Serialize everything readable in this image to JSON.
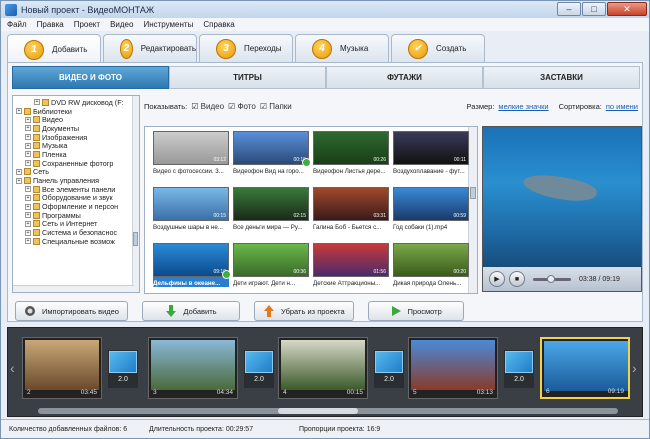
{
  "window": {
    "title": "Новый проект - ВидеоМОНТАЖ",
    "minimize": "–",
    "maximize": "□",
    "close": "✕"
  },
  "menu": [
    "Файл",
    "Правка",
    "Проект",
    "Видео",
    "Инструменты",
    "Справка"
  ],
  "steps": [
    {
      "num": "1",
      "label": "Добавить"
    },
    {
      "num": "2",
      "label": "Редактировать"
    },
    {
      "num": "3",
      "label": "Переходы"
    },
    {
      "num": "4",
      "label": "Музыка"
    },
    {
      "num": "✓",
      "label": "Создать"
    }
  ],
  "subtabs": [
    "ВИДЕО И ФОТО",
    "ТИТРЫ",
    "ФУТАЖИ",
    "ЗАСТАВКИ"
  ],
  "tree": [
    "DVD RW дисковод (F:",
    "Библиотеки",
    "Видео",
    "Документы",
    "Изображения",
    "Музыка",
    "Пленка",
    "Сохраненные фотогр",
    "Сеть",
    "Панель управления",
    "Все элементы панели",
    "Оборудование и звук",
    "Оформление и персон",
    "Программы",
    "Сеть и Интернет",
    "Система и безопаснос",
    "Специальные возмож"
  ],
  "filter": {
    "show_label": "Показывать:",
    "video": "Видео",
    "photo": "Фото",
    "folders": "Папки",
    "size_label": "Размер:",
    "size_value": "мелкие значки",
    "sort_label": "Сортировка:",
    "sort_value": "по имени"
  },
  "files": [
    {
      "name": "Видео с фотосессии. 3...",
      "dur": "03:12"
    },
    {
      "name": "Видеофон Вид на горо...",
      "dur": "00:15"
    },
    {
      "name": "Видеофон Листья дере...",
      "dur": "00:26"
    },
    {
      "name": "Воздухоплавание - фут...",
      "dur": "00:11"
    },
    {
      "name": "Воздушные шары в не...",
      "dur": "00:15"
    },
    {
      "name": "Все деньги мира — Ру...",
      "dur": "02:15"
    },
    {
      "name": "Галина Боб - Бьется с...",
      "dur": "03:31"
    },
    {
      "name": "Год собаки (1).mp4",
      "dur": "00:59"
    },
    {
      "name": "Дельфины в океане...",
      "dur": "09:19"
    },
    {
      "name": "Дети играют. Дети н...",
      "dur": "00:36"
    },
    {
      "name": "Детские Аттракционы...",
      "dur": "01:56"
    },
    {
      "name": "Дикая природа Олень...",
      "dur": "00:20"
    }
  ],
  "player": {
    "time": "03:38 / 09:19",
    "play": "▶",
    "stop": "■"
  },
  "actions": [
    "Импортировать видео",
    "Добавить",
    "Убрать из проекта",
    "Просмотр"
  ],
  "clips": [
    {
      "num": "2",
      "dur": "03:45"
    },
    {
      "num": "3",
      "dur": "04:34"
    },
    {
      "num": "4",
      "dur": "00:15"
    },
    {
      "num": "5",
      "dur": "03:13"
    },
    {
      "num": "6",
      "dur": "09:19"
    }
  ],
  "transitions": [
    "2.0",
    "2.0",
    "2.0",
    "2.0",
    "2.0"
  ],
  "status": {
    "files": "Количество добавленных файлов: 6",
    "duration": "Длительность проекта: 00:29:57",
    "ratio": "Пропорции проекта: 16:9"
  }
}
